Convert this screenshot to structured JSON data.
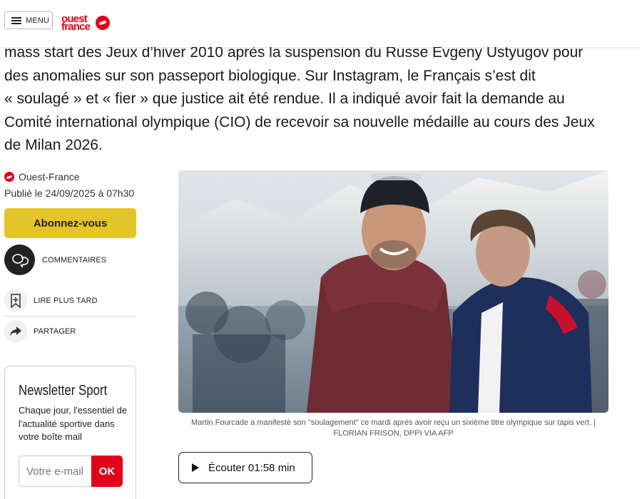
{
  "header": {
    "menu_label": "MENU",
    "logo": {
      "line1": "ouest",
      "line2": "france",
      "brand_color": "#e2001a"
    }
  },
  "article": {
    "lines": [
      "mass start des Jeux d’hiver 2010 après la suspension du Russe Evgeny Ustyugov pour",
      "des anomalies sur son passeport biologique. Sur Instagram, le Français s’est dit",
      "« soulagé » et « fier » que justice ait été rendue. Il a indiqué avoir fait la demande au",
      "Comité international olympique (CIO) de recevoir sa nouvelle médaille au cours des Jeux",
      "de Milan 2026."
    ]
  },
  "meta": {
    "source": "Ouest-France",
    "published": "Publié le 24/09/2025 à 07h30"
  },
  "actions": {
    "subscribe": "Abonnez-vous",
    "comments": "COMMENTAIRES",
    "read_later": "LIRE PLUS TARD",
    "share": "PARTAGER"
  },
  "newsletter": {
    "title": "Newsletter Sport",
    "description": "Chaque jour, l'essentiel de l'actualité sportive dans votre boîte mail",
    "email_placeholder": "Votre e-mail",
    "submit_label": "OK"
  },
  "photo": {
    "caption_line1": "Martin Fourcade a manifesté son \"soulagement\" ce mardi après avoir reçu un sixième titre olympique sur tapis vert. |",
    "caption_line2": "FLORIAN FRISON, DPPI VIA AFP"
  },
  "audio": {
    "listen_label": "Écouter 01:58 min"
  },
  "colors": {
    "accent_red": "#e2001a",
    "subscribe_yellow": "#e4c529"
  }
}
